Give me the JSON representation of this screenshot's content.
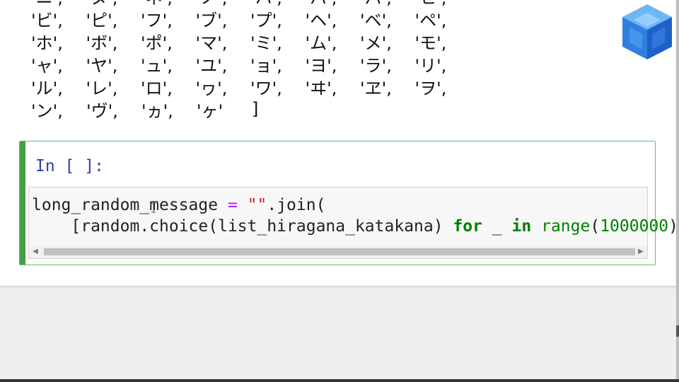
{
  "output": {
    "lines": [
      [
        "'ニ',",
        "'ヌ',",
        "'ネ',",
        "'ノ',",
        "'ハ',",
        "'バ',",
        "'パ',",
        "'ヒ',"
      ],
      [
        "'ビ',",
        "'ピ',",
        "'フ',",
        "'ブ',",
        "'プ',",
        "'ヘ',",
        "'ベ',",
        "'ペ',"
      ],
      [
        "'ホ',",
        "'ボ',",
        "'ポ',",
        "'マ',",
        "'ミ',",
        "'ム',",
        "'メ',",
        "'モ',"
      ],
      [
        "'ャ',",
        "'ヤ',",
        "'ュ',",
        "'ユ',",
        "'ョ',",
        "'ヨ',",
        "'ラ',",
        "'リ',"
      ],
      [
        "'ル',",
        "'レ',",
        "'ロ',",
        "'ヮ',",
        "'ワ',",
        "'ヰ',",
        "'ヱ',",
        "'ヲ',"
      ],
      [
        "'ン',",
        "'ヴ',",
        "'ヵ',",
        "'ヶ'"
      ]
    ],
    "closing": "]"
  },
  "cell": {
    "prompt": "In [ ]:",
    "code": {
      "line1": {
        "var": "long_random_message ",
        "eq": "=",
        "str": " \"\"",
        "join": ".join("
      },
      "line2": {
        "indent": "    ",
        "open": "[random.choice(list_hiragana_katakana) ",
        "kw_for": "for",
        "underscore": " _ ",
        "kw_in": "in",
        "space": " ",
        "builtin": "range",
        "paren_open": "(",
        "num": "1000000",
        "close": ")])"
      }
    }
  },
  "icons": {
    "logo": "cube-logo-icon",
    "scroll_left": "scroll-left-arrow-icon",
    "scroll_right": "scroll-right-arrow-icon",
    "mouse": "ibeam-cursor-icon"
  },
  "colors": {
    "cell_border": "#66bb6a",
    "cell_bar": "#42a045",
    "prompt": "#303f9f",
    "keyword": "#008000",
    "operator": "#aa22ff",
    "string": "#ba2121"
  }
}
